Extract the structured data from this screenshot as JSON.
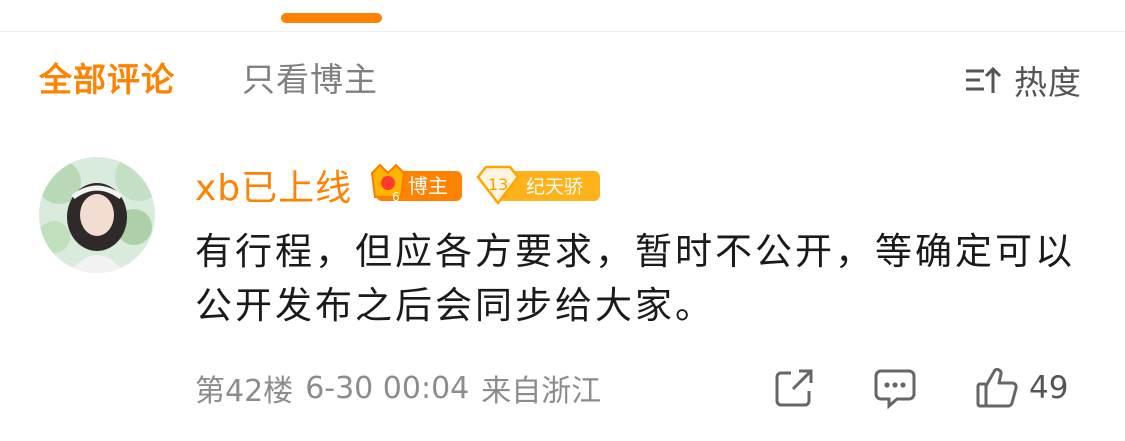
{
  "header": {
    "filters": [
      "全部评论",
      "只看博主"
    ],
    "sort_label": "热度"
  },
  "comment": {
    "username": "xb已上线",
    "badges": {
      "blogger_level": "6",
      "blogger_label": "博主",
      "fan_level": "13",
      "fan_label": "纪天骄"
    },
    "text": "有行程，但应各方要求，暂时不公开，等确定可以公开发布之后会同步给大家。",
    "floor": "第42楼",
    "datetime": "6-30 00:04",
    "location": "来自浙江",
    "like_count": "49"
  },
  "colors": {
    "accent": "#ff8200",
    "text": "#1a1a1a",
    "muted": "#8c8c8c"
  },
  "icons": [
    "sort-icon",
    "share-icon",
    "comment-icon",
    "like-icon",
    "crown-icon",
    "diamond-icon"
  ]
}
